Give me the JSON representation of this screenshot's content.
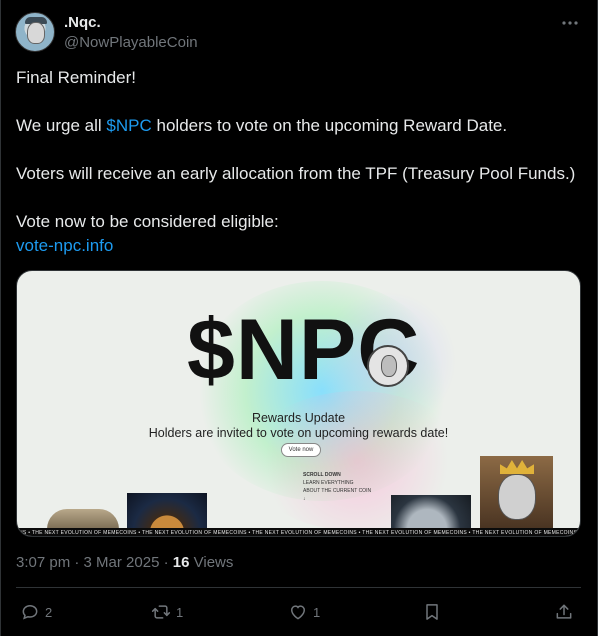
{
  "author": {
    "display_name": ".Nqc.",
    "handle": "@NowPlayableCoin",
    "avatar_icon": "npc-avatar",
    "menu_icon": "more-horizontal-icon"
  },
  "tweet": {
    "lines": [
      "Final Reminder!",
      "",
      "We urge all",
      "holders to vote on the upcoming Reward Date.",
      "",
      "Voters will receive an early allocation from the TPF (Treasury Pool Funds.)",
      "",
      "Vote now to be considered eligible:"
    ],
    "cashtag": "$NPC",
    "link": "vote-npc.info"
  },
  "media": {
    "big_text": "$NPC",
    "rewards_title": "Rewards Update",
    "rewards_subtitle": "Holders are invited to vote on upcoming rewards date!",
    "vote_button": "Vote now",
    "scroll_lines": [
      "SCROLL DOWN",
      "LEARN EVERYTHING",
      "ABOUT THE CURRENT COIN",
      "↓"
    ],
    "ticker": "NS  •  THE NEXT EVOLUTION OF MEMECOINS  •   THE NEXT EVOLUTION OF MEMECOINS  •   THE NEXT EVOLUTION OF MEMECOINS  •   THE NEXT EVOLUTION OF MEMECOINS  •   THE NEXT EVOLUTION OF MEMECOINS  •   THE NE"
  },
  "meta": {
    "time": "3:07 pm",
    "separator": "·",
    "date": "3 Mar 2025",
    "views_count": "16",
    "views_label": "Views"
  },
  "actions": {
    "reply_count": "2",
    "repost_count": "1",
    "like_count": "1",
    "icons": [
      "reply-icon",
      "repost-icon",
      "like-icon",
      "bookmark-icon",
      "share-icon"
    ]
  },
  "colors": {
    "background": "#000000",
    "text": "#e7e9ea",
    "muted": "#71767b",
    "accent": "#1d9bf0"
  }
}
